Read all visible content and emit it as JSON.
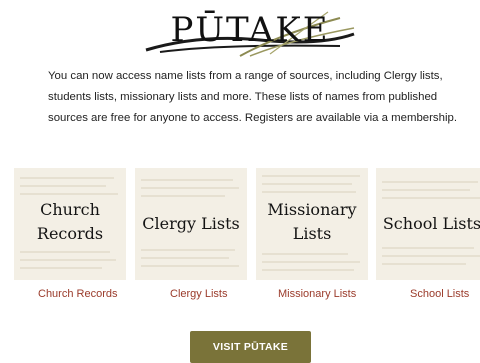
{
  "logo": {
    "text": "PŪTAKE"
  },
  "intro": "You can now access name lists from a range of sources, including Clergy lists, students lists, missionary lists and more. These lists of names from published sources are free for anyone to access. Registers are available via a membership.",
  "cards": [
    {
      "title_line1": "Church",
      "title_line2": "Records",
      "link": "Church Records"
    },
    {
      "title_line1": "Clergy Lists",
      "title_line2": "",
      "link": "Clergy Lists"
    },
    {
      "title_line1": "Missionary",
      "title_line2": "Lists",
      "link": "Missionary Lists"
    },
    {
      "title_line1": "School Lists",
      "title_line2": "",
      "link": "School Lists"
    }
  ],
  "visit_button": "VISIT PŪTAKE",
  "colors": {
    "link": "#9a3a2a",
    "button": "#7a7339",
    "card_bg": "#f3efe5"
  }
}
